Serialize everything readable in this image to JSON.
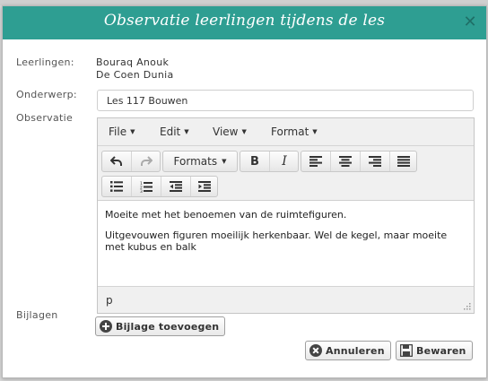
{
  "dialog": {
    "title": "Observatie leerlingen tijdens de les",
    "close_icon": "close-icon"
  },
  "form": {
    "students_label": "Leerlingen:",
    "students": [
      "Bouraq Anouk",
      "De Coen Dunia"
    ],
    "subject_label": "Onderwerp:",
    "subject_value": "Les 117 Bouwen",
    "observation_label": "Observatie",
    "attachments_label": "Bijlagen"
  },
  "editor": {
    "menus": [
      "File",
      "Edit",
      "View",
      "Format"
    ],
    "formats_label": "Formats",
    "bold_label": "B",
    "italic_label": "I",
    "paragraphs": [
      "Moeite met het benoemen van de ruimtefiguren.",
      "Uitgevouwen figuren moeilijk herkenbaar. Wel de kegel, maar moeite met kubus en balk"
    ],
    "status_path": "p"
  },
  "buttons": {
    "add_attachment": "Bijlage toevoegen",
    "cancel": "Annuleren",
    "save": "Bewaren"
  },
  "colors": {
    "titlebar": "#2e9e92",
    "title_text": "#ffffff"
  }
}
